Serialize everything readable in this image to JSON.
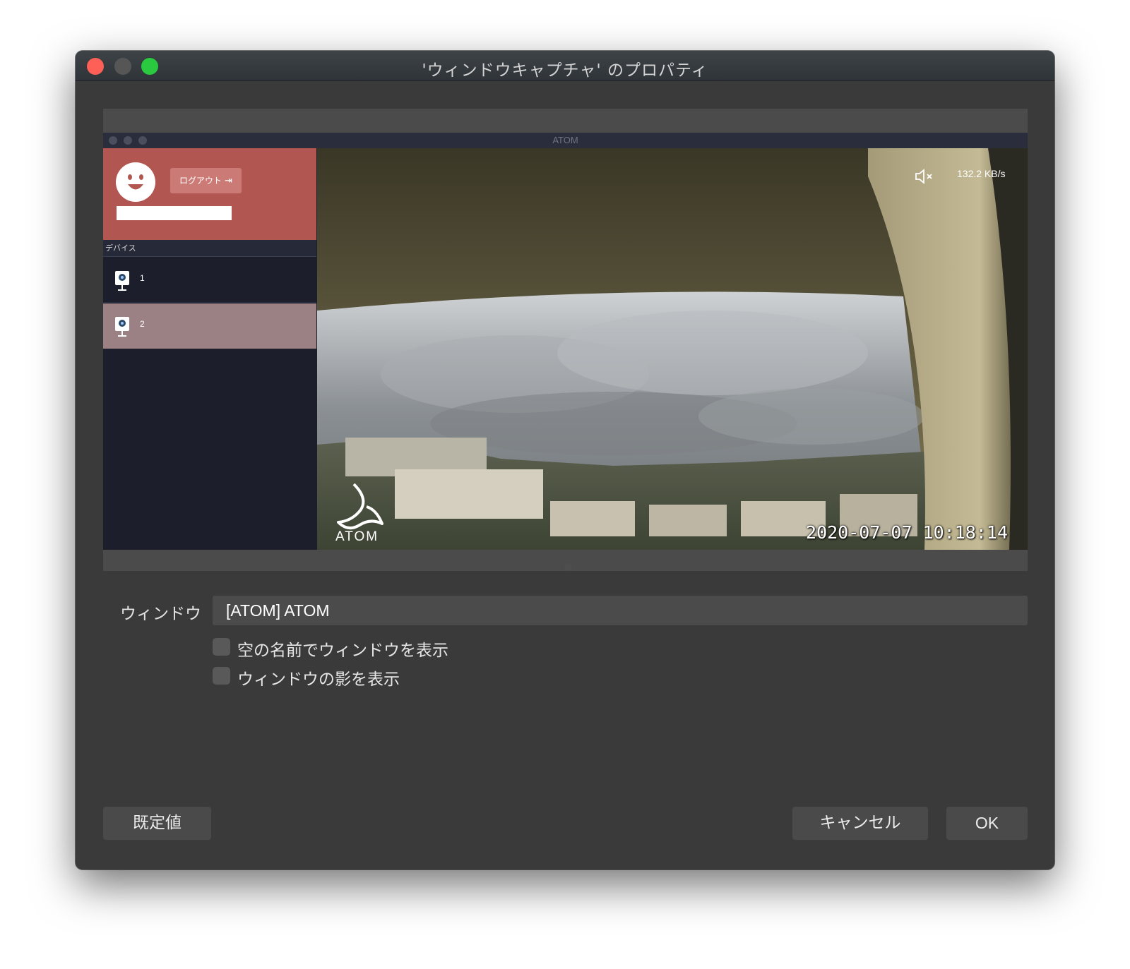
{
  "window": {
    "title": "'ウィンドウキャプチャ' のプロパティ"
  },
  "preview": {
    "app_title": "ATOM",
    "sidebar": {
      "logout_label": "ログアウト",
      "devices_header": "デバイス",
      "devices": [
        {
          "label": "1",
          "selected": false
        },
        {
          "label": "2",
          "selected": true
        }
      ]
    },
    "video": {
      "bitrate": "132.2 KB/s",
      "logo_text": "ATOM",
      "timestamp": "2020-07-07  10:18:14"
    }
  },
  "form": {
    "window_label": "ウィンドウ",
    "window_value": "[ATOM] ATOM",
    "checkboxes": [
      {
        "label": "空の名前でウィンドウを表示",
        "checked": false
      },
      {
        "label": "ウィンドウの影を表示",
        "checked": false
      }
    ]
  },
  "buttons": {
    "defaults": "既定値",
    "cancel": "キャンセル",
    "ok": "OK"
  },
  "colors": {
    "close": "#fe5f57",
    "maximize": "#29c940",
    "sidebar_accent": "#b25651",
    "selected_device": "#9b8183"
  }
}
